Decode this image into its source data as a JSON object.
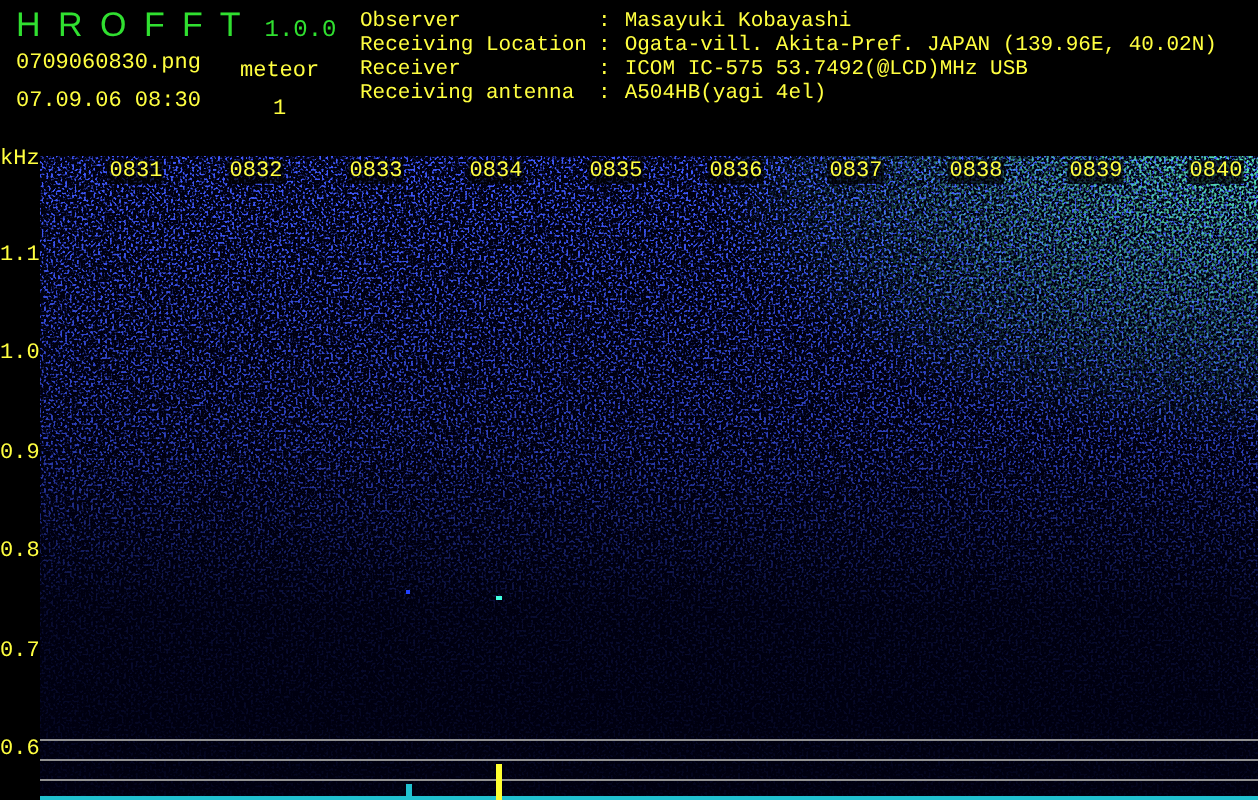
{
  "app": {
    "title": "H R O F F T",
    "version": "1.0.0",
    "filename": "0709060830.png",
    "datetime": "07.09.06 08:30",
    "meteor_label": "meteor",
    "meteor_count": "1"
  },
  "info": [
    {
      "label": "Observer",
      "separator": ":",
      "value": "Masayuki Kobayashi"
    },
    {
      "label": "Receiving Location",
      "separator": ":",
      "value": "Ogata-vill. Akita-Pref. JAPAN (139.96E, 40.02N)"
    },
    {
      "label": "Receiver",
      "separator": ":",
      "value": "ICOM IC-575 53.7492(@LCD)MHz USB"
    },
    {
      "label": "Receiving antenna",
      "separator": ":",
      "value": "A504HB(yagi 4el)"
    }
  ],
  "spectrogram": {
    "y_unit": "kHz",
    "y_labels": [
      "1.1",
      "1.0",
      "0.9",
      "0.8",
      "0.7",
      "0.6"
    ],
    "time_labels": [
      "0831",
      "0832",
      "0833",
      "0834",
      "0835",
      "0836",
      "0837",
      "0838",
      "0839",
      "0840"
    ]
  }
}
